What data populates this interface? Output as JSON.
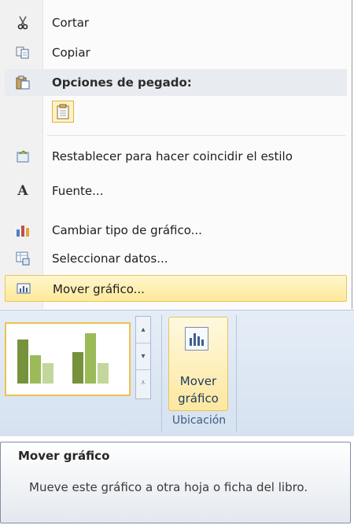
{
  "context_menu": {
    "items": [
      {
        "label": "Cortar",
        "icon": "scissors-icon"
      },
      {
        "label": "Copiar",
        "icon": "copy-icon"
      },
      {
        "label": "Opciones de pegado:",
        "icon": "paste-icon",
        "type": "header"
      },
      {
        "label": "",
        "icon": "paste-option-icon",
        "type": "paste-option"
      },
      {
        "label": "Restablecer para hacer coincidir el estilo",
        "icon": "reset-style-icon"
      },
      {
        "label": "Fuente...",
        "icon": "font-icon"
      },
      {
        "label": "Cambiar tipo de gráfico...",
        "icon": "chart-type-icon"
      },
      {
        "label": "Seleccionar datos...",
        "icon": "select-data-icon"
      },
      {
        "label": "Mover gráfico...",
        "icon": "move-chart-icon",
        "highlighted": true
      }
    ]
  },
  "ribbon": {
    "mover_button": {
      "line1": "Mover",
      "line2": "gráfico"
    },
    "group_label": "Ubicación"
  },
  "tooltip": {
    "title": "Mover gráfico",
    "body": "Mueve este gráfico a otra hoja o ficha del libro."
  },
  "colors": {
    "highlight": "#fde99a",
    "ribbon_bg": "#dbe5f1",
    "bar_dark": "#76923c",
    "bar_mid": "#9bbb59",
    "bar_light": "#c3d69b"
  }
}
